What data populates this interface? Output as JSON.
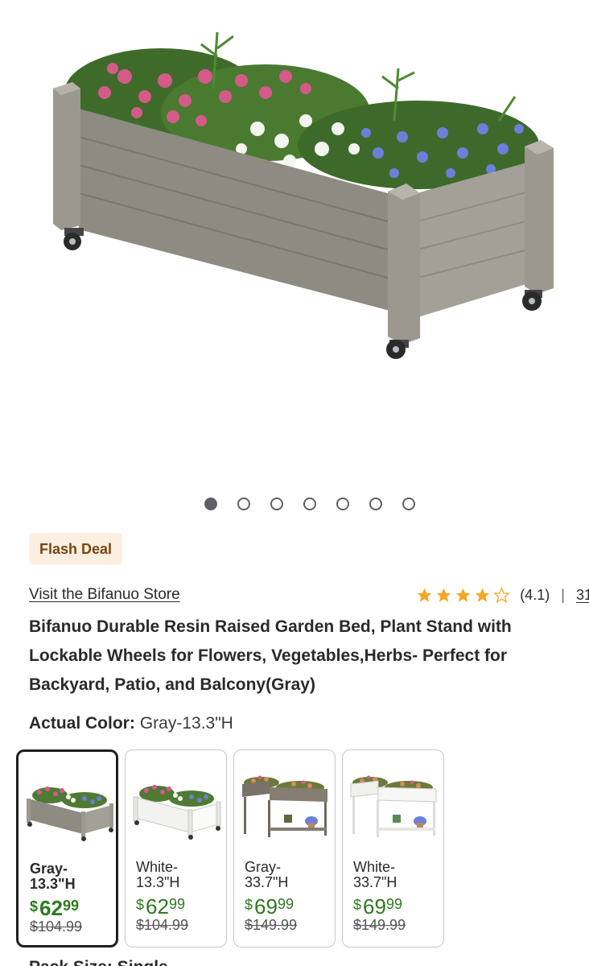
{
  "gallery": {
    "image_alt": "Gray resin raised garden bed on wheels with pink, white and blue flowers",
    "dot_count": 7,
    "active_index": 0
  },
  "badge": {
    "label": "Flash Deal"
  },
  "store": {
    "link_text": "Visit the Bifanuo Store"
  },
  "rating": {
    "stars": 4.1,
    "value_text": "(4.1)",
    "separator": "|",
    "review_count": "31",
    "star_color": "#f5a623"
  },
  "product": {
    "title": "Bifanuo Durable Resin Raised Garden Bed, Plant Stand with Lockable Wheels for Flowers, Vegetables,Herbs- Perfect for Backyard, Patio, and Balcony(Gray)"
  },
  "color_selector": {
    "label": "Actual Color:",
    "value": "Gray-13.3\"H"
  },
  "variants": [
    {
      "name": "Gray-\n13.3\"H",
      "currency": "$",
      "whole": "62",
      "cents": "99",
      "old_price": "$104.99",
      "selected": true
    },
    {
      "name": "White-\n13.3\"H",
      "currency": "$",
      "whole": "62",
      "cents": "99",
      "old_price": "$104.99",
      "selected": false
    },
    {
      "name": "Gray-\n33.7\"H",
      "currency": "$",
      "whole": "69",
      "cents": "99",
      "old_price": "$149.99",
      "selected": false
    },
    {
      "name": "White-\n33.7\"H",
      "currency": "$",
      "whole": "69",
      "cents": "99",
      "old_price": "$149.99",
      "selected": false
    }
  ],
  "next_section": {
    "label": "Pack Size: Single"
  },
  "colors": {
    "price_green": "#2d7a1f",
    "badge_bg": "#fbefe2",
    "badge_text": "#7a4510"
  }
}
